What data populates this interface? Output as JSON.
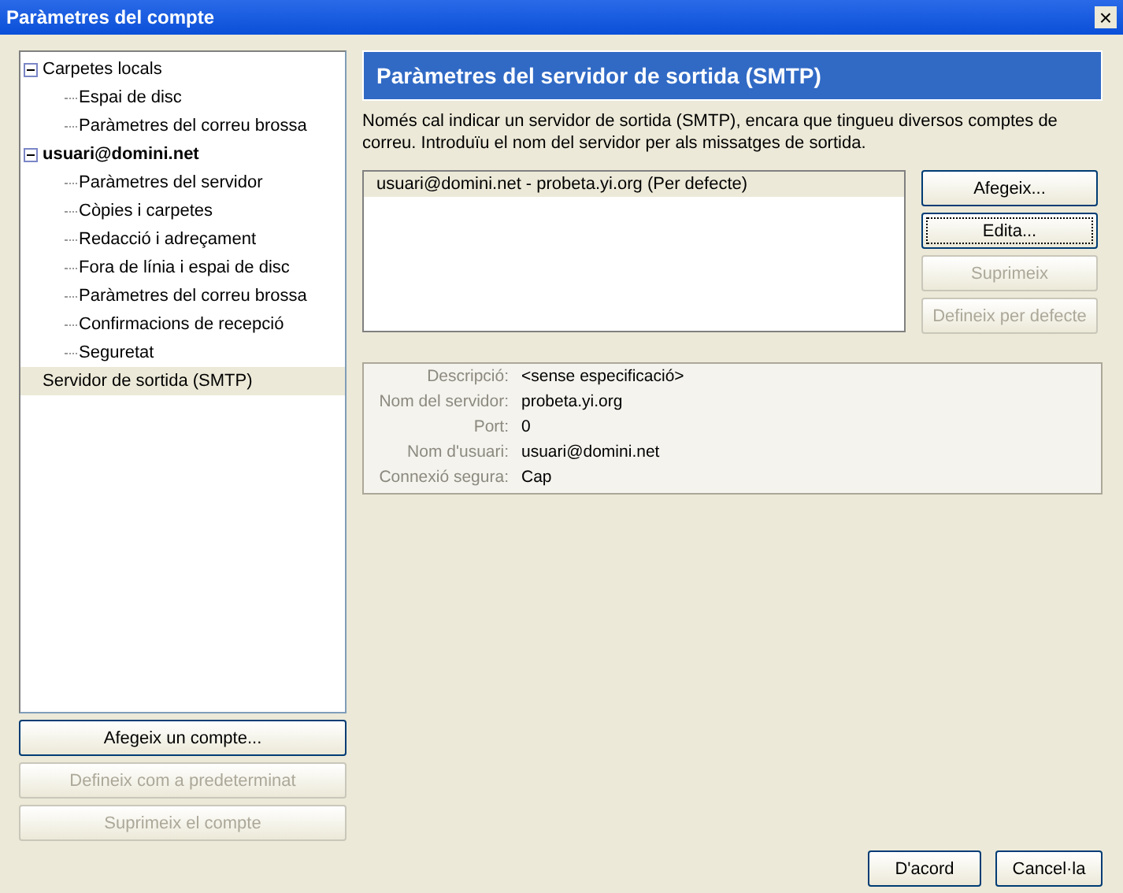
{
  "window": {
    "title": "Paràmetres del compte",
    "close": "×"
  },
  "tree": [
    {
      "label": "Carpetes locals",
      "kind": "folder",
      "expanded": true,
      "selected": false,
      "children": [
        {
          "label": "Espai de disc",
          "selected": false
        },
        {
          "label": "Paràmetres del correu brossa",
          "selected": false
        }
      ]
    },
    {
      "label": "usuari@domini.net",
      "kind": "account",
      "expanded": true,
      "selected": false,
      "children": [
        {
          "label": "Paràmetres del servidor",
          "selected": false
        },
        {
          "label": "Còpies i carpetes",
          "selected": false
        },
        {
          "label": "Redacció i adreçament",
          "selected": false
        },
        {
          "label": "Fora de línia i espai de disc",
          "selected": false
        },
        {
          "label": "Paràmetres del correu brossa",
          "selected": false
        },
        {
          "label": "Confirmacions de recepció",
          "selected": false
        },
        {
          "label": "Seguretat",
          "selected": false
        }
      ]
    },
    {
      "label": "Servidor de sortida (SMTP)",
      "kind": "server",
      "selected": true
    }
  ],
  "account_buttons": [
    {
      "label": "Afegeix un compte...",
      "disabled": false
    },
    {
      "label": "Defineix com a predeterminat",
      "disabled": true
    },
    {
      "label": "Suprimeix el compte",
      "disabled": true
    }
  ],
  "panel": {
    "title": "Paràmetres del servidor de sortida (SMTP)",
    "description": "Només cal indicar un servidor de sortida (SMTP), encara que tingueu diversos comptes de correu. Introduïu el nom del servidor per als missatges de sortida.",
    "servers": [
      {
        "label": "usuari@domini.net - probeta.yi.org (Per defecte)",
        "selected": true
      }
    ],
    "buttons": [
      {
        "label": "Afegeix...",
        "disabled": false,
        "focused": false
      },
      {
        "label": "Edita...",
        "disabled": false,
        "focused": true
      },
      {
        "label": "Suprimeix",
        "disabled": true,
        "focused": false
      },
      {
        "label": "Defineix per defecte",
        "disabled": true,
        "focused": false
      }
    ],
    "details": [
      {
        "label": "Descripció:",
        "value": "<sense especificació>"
      },
      {
        "label": "Nom del servidor:",
        "value": "probeta.yi.org"
      },
      {
        "label": "Port:",
        "value": "0"
      },
      {
        "label": "Nom d'usuari:",
        "value": "usuari@domini.net"
      },
      {
        "label": "Connexió segura:",
        "value": "Cap"
      }
    ]
  },
  "dialog_buttons": [
    {
      "label": "D'acord"
    },
    {
      "label": "Cancel·la"
    }
  ]
}
